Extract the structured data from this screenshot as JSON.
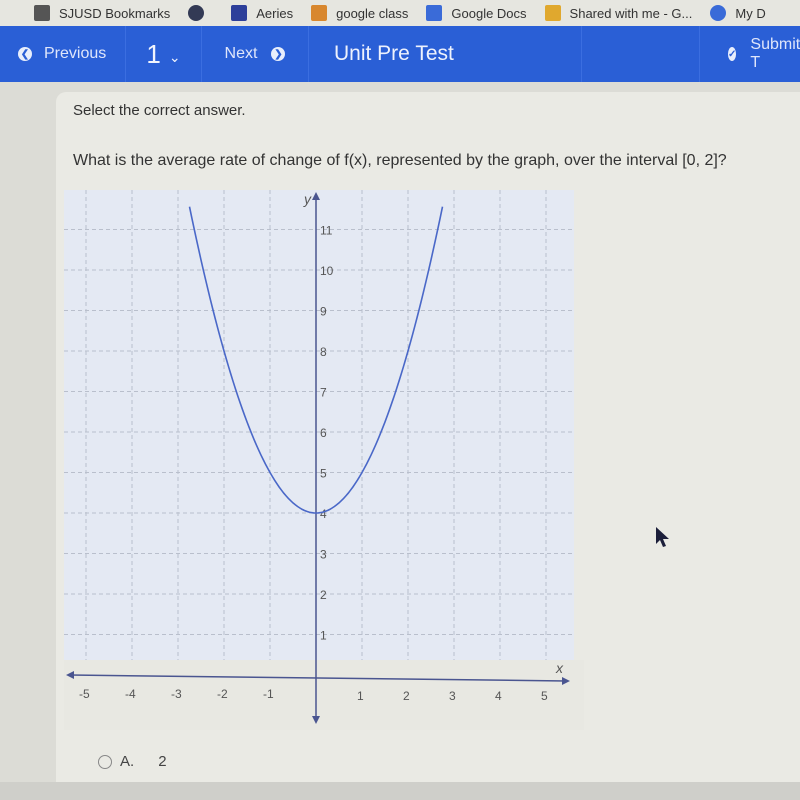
{
  "bookmarks": [
    {
      "label": "SJUSD Bookmarks",
      "icon": "folder-icon",
      "color": "#555555"
    },
    {
      "label": "",
      "icon": "globe-icon",
      "color": "#333a55"
    },
    {
      "label": "Aeries",
      "icon": "aeries-logo-icon",
      "color": "#2d3f9a"
    },
    {
      "label": "google class",
      "icon": "classroom-icon",
      "color": "#d8872e"
    },
    {
      "label": "Google Docs",
      "icon": "docs-icon",
      "color": "#3a6bd8"
    },
    {
      "label": "Shared with me - G...",
      "icon": "drive-icon",
      "color": "#e0a82e"
    },
    {
      "label": "My D",
      "icon": "play-circle-icon",
      "color": "#3a6bd8"
    }
  ],
  "toolbar": {
    "previous_label": "Previous",
    "question_number": "1",
    "next_label": "Next",
    "title": "Unit Pre Test",
    "submit_label": "Submit T"
  },
  "question": {
    "instruction": "Select the correct answer.",
    "text": "What is the average rate of change of f(x), represented by the graph, over the interval [0, 2]?",
    "choices": [
      {
        "letter": "A.",
        "value": "2",
        "selected": false
      }
    ]
  },
  "chart_data": {
    "type": "line",
    "title": "",
    "xlabel": "x",
    "ylabel": "y",
    "xlim": [
      -5.5,
      5.5
    ],
    "ylim": [
      -2,
      12
    ],
    "grid": true,
    "x_ticks": [
      -5,
      -4,
      -3,
      -2,
      -1,
      1,
      2,
      3,
      4,
      5
    ],
    "y_ticks": [
      1,
      2,
      3,
      4,
      5,
      6,
      7,
      8,
      9,
      10,
      11
    ],
    "series": [
      {
        "name": "f(x)",
        "function": "x^2 + 4",
        "color": "#4a68c8",
        "points": [
          [
            -2.83,
            12
          ],
          [
            -2.5,
            10.25
          ],
          [
            -2,
            8
          ],
          [
            -1.5,
            6.25
          ],
          [
            -1,
            5
          ],
          [
            -0.5,
            4.25
          ],
          [
            0,
            4
          ],
          [
            0.5,
            4.25
          ],
          [
            1,
            5
          ],
          [
            1.5,
            6.25
          ],
          [
            2,
            8
          ],
          [
            2.5,
            10.25
          ],
          [
            2.83,
            12
          ]
        ]
      }
    ]
  },
  "colors": {
    "topbar": "#2a5fd6",
    "graph_bg": "#e4e9f3",
    "axis": "#4a5590",
    "curve": "#4a68c8"
  }
}
